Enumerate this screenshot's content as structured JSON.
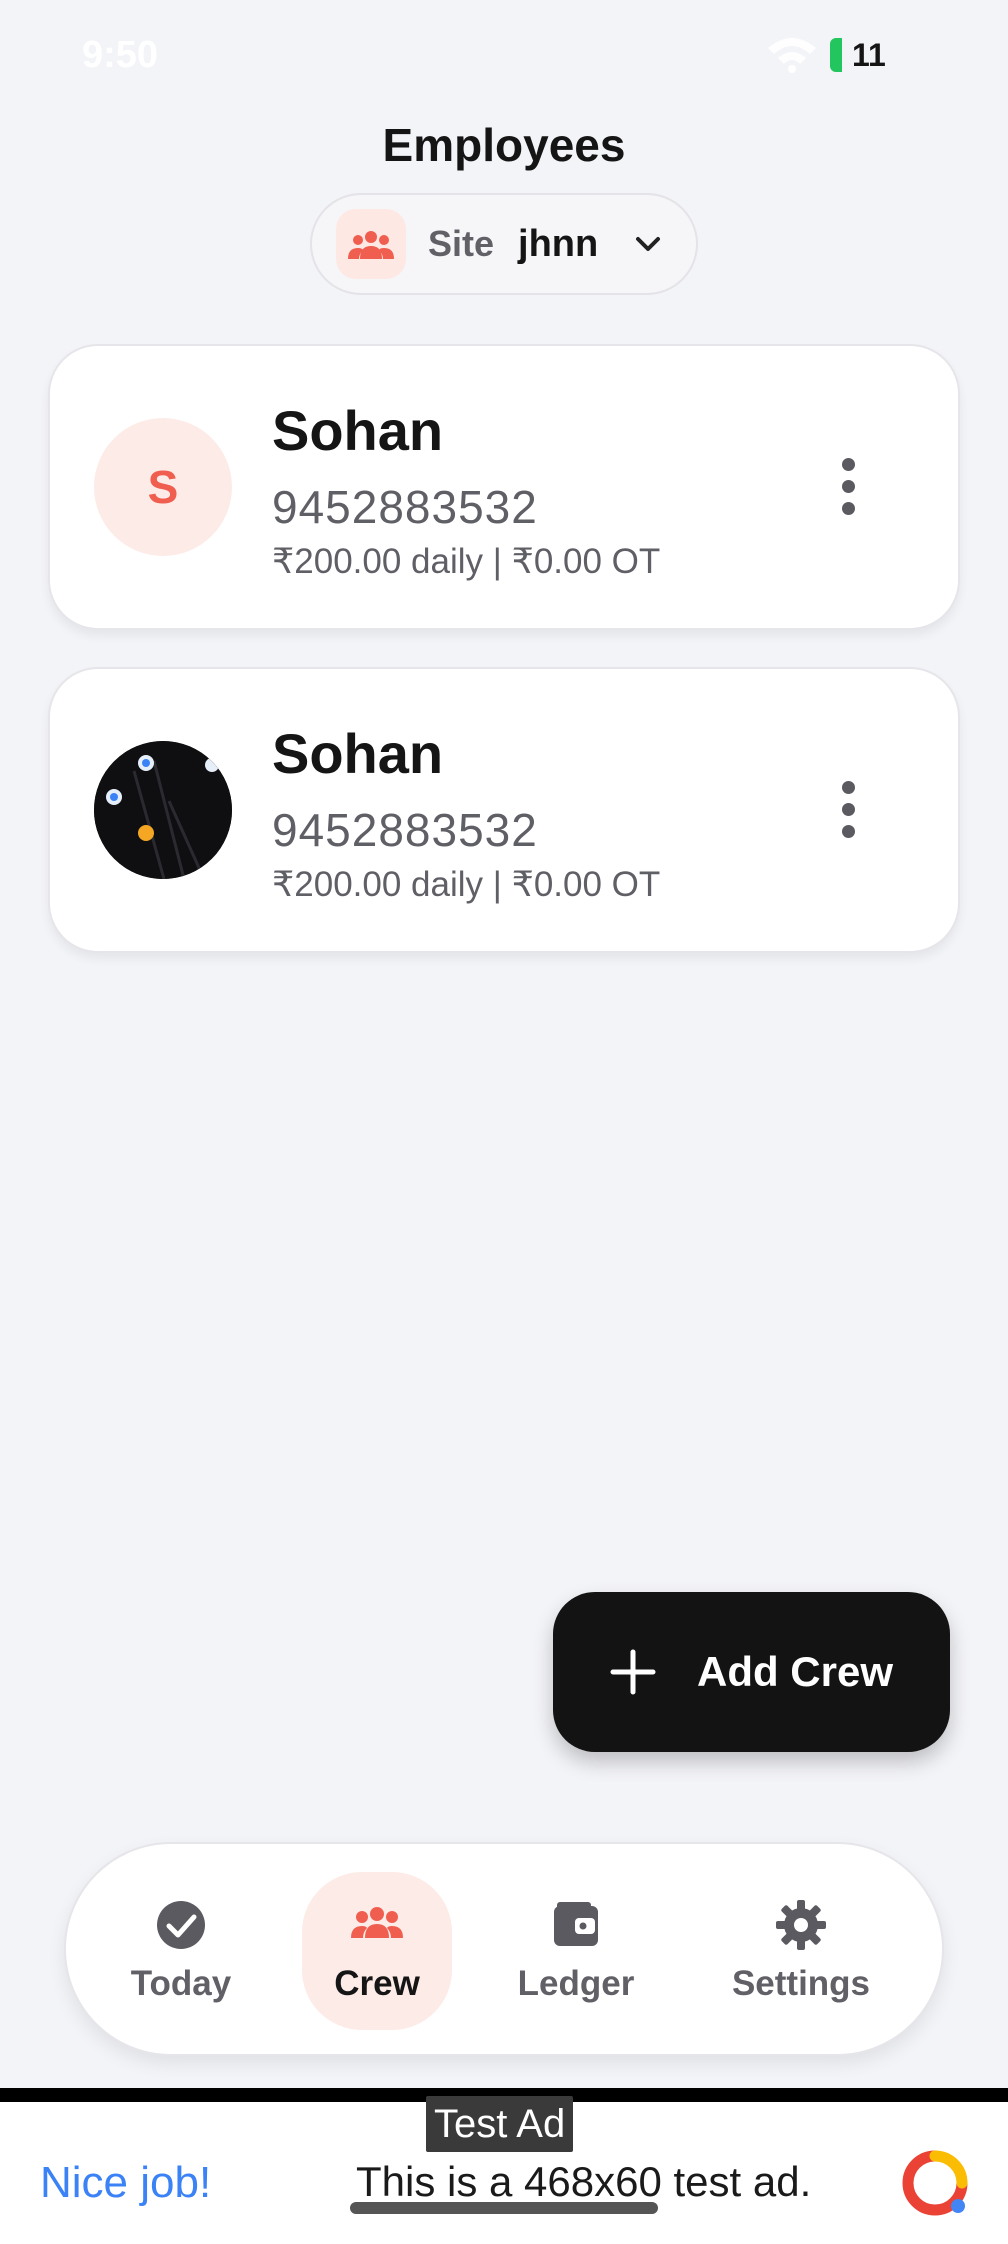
{
  "status_bar": {
    "time": "9:50",
    "battery": "11"
  },
  "header": {
    "title": "Employees"
  },
  "site_selector": {
    "label": "Site",
    "value": "jhnn"
  },
  "employees": [
    {
      "name": "Sohan",
      "phone": "9452883532",
      "wage": "₹200.00 daily | ₹0.00 OT",
      "initial": "S"
    },
    {
      "name": "Sohan",
      "phone": "9452883532",
      "wage": "₹200.00 daily | ₹0.00 OT"
    }
  ],
  "fab": {
    "label": "Add Crew"
  },
  "nav": {
    "items": [
      {
        "label": "Today",
        "icon": "check-circle-icon"
      },
      {
        "label": "Crew",
        "icon": "group-icon",
        "active": true
      },
      {
        "label": "Ledger",
        "icon": "wallet-icon"
      },
      {
        "label": "Settings",
        "icon": "gear-icon"
      }
    ]
  },
  "ad": {
    "tag": "Test Ad",
    "nice": "Nice job!",
    "text": "This is a 468x60 test ad."
  },
  "colors": {
    "accent": "#ef5e4f",
    "accent_bg": "#fdebe7",
    "fab_bg": "#131313",
    "ad_link": "#3b82f6"
  }
}
